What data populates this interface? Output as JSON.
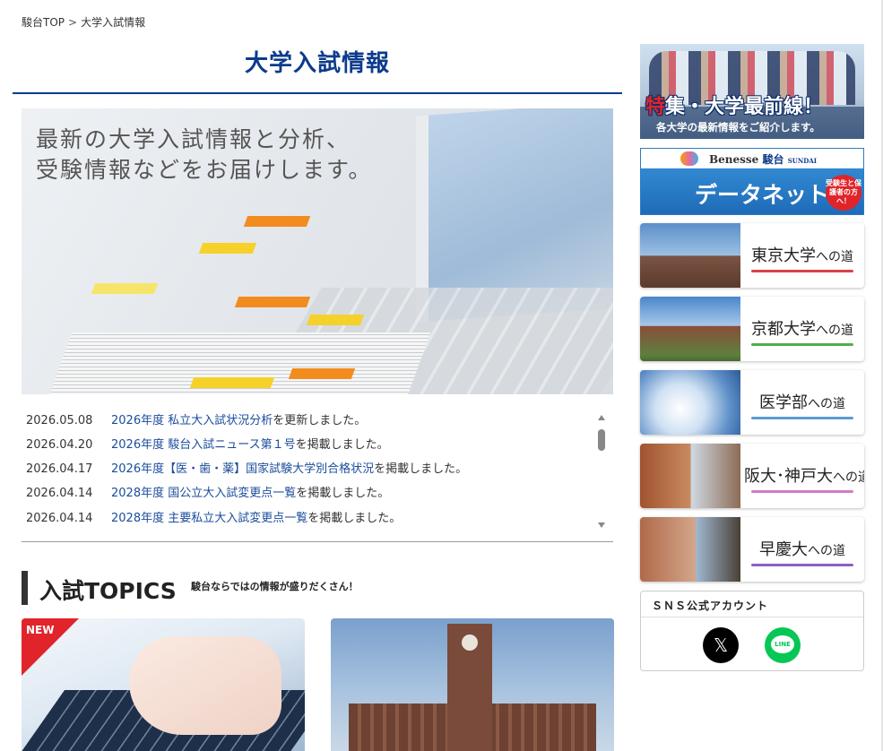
{
  "breadcrumb": {
    "home": "駿台TOP",
    "separator": ">",
    "current": "大学入試情報"
  },
  "page": {
    "title": "大学入試情報"
  },
  "hero": {
    "line1": "最新の大学入試情報と分析、",
    "line2": "受験情報などをお届けします。"
  },
  "news": [
    {
      "date": "2026.05.08",
      "link": "2026年度 私立大入試状況分析",
      "suffix": "を更新しました。"
    },
    {
      "date": "2026.04.20",
      "link": "2026年度 駿台入試ニュース第１号",
      "suffix": "を掲載しました。"
    },
    {
      "date": "2026.04.17",
      "link": "2026年度【医・歯・薬】国家試験大学別合格状況",
      "suffix": "を掲載しました。"
    },
    {
      "date": "2026.04.14",
      "link": "2028年度 国公立大入試変更点一覧",
      "suffix": "を掲載しました。"
    },
    {
      "date": "2026.04.14",
      "link": "2028年度 主要私立大入試変更点一覧",
      "suffix": "を掲載しました。"
    }
  ],
  "topics": {
    "title": "入試TOPICS",
    "subtitle": "駿台ならではの情報が盛りだくさん！",
    "new_badge": "NEW"
  },
  "sidebar": {
    "special": {
      "red_char": "特",
      "caption_rest": "集・大学最前線！",
      "sub": "各大学の最新情報をご紹介します。"
    },
    "datanet": {
      "brand1": "Benesse",
      "brand2": "駿台",
      "brand3": "SUNDAI",
      "title": "データネット",
      "pill": "受験生と保護者の方へ！"
    },
    "roads": [
      {
        "name": "東京大学",
        "suffix": "への道",
        "underline": "#d8434b"
      },
      {
        "name": "京都大学",
        "suffix": "への道",
        "underline": "#4caf50"
      },
      {
        "name": "医学部",
        "suffix": "への道",
        "underline": "#5b9bd5"
      },
      {
        "name": "阪大･神戸大",
        "suffix": "への道",
        "underline": "#d17bc6"
      },
      {
        "name": "早慶大",
        "suffix": "への道",
        "underline": "#8e5fc2"
      }
    ],
    "sns": {
      "title": "ＳＮＳ公式アカウント",
      "x_glyph": "𝕏",
      "line_label": "LINE"
    }
  }
}
